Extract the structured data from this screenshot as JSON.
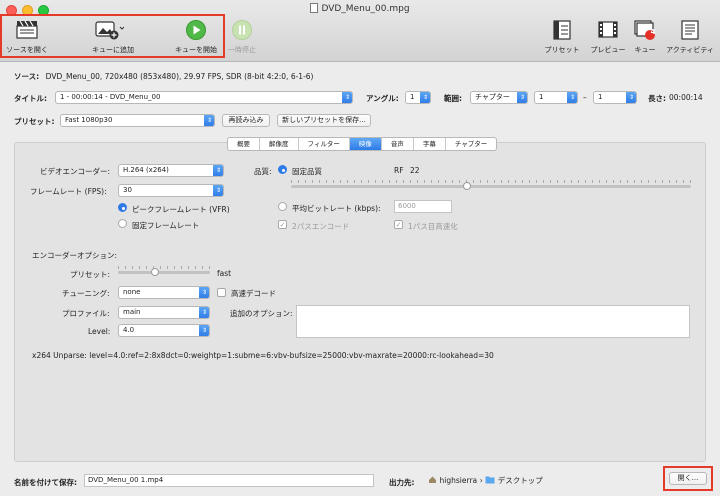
{
  "window": {
    "title": "DVD_Menu_00.mpg"
  },
  "toolbar": {
    "open_source": "ソースを開く",
    "add_to_queue": "キューに追加",
    "start_queue": "キューを開始",
    "pause": "一時停止",
    "presets": "プリセット",
    "preview": "プレビュー",
    "queue": "キュー",
    "queue_badge": "4",
    "activity": "アクティビティ"
  },
  "source": {
    "label": "ソース:",
    "value": "DVD_Menu_00, 720x480 (853x480), 29.97 FPS, SDR (8-bit 4:2:0, 6-1-6)"
  },
  "title_row": {
    "label": "タイトル:",
    "value": "1 - 00:00:14 - DVD_Menu_00",
    "angle_label": "アングル:",
    "angle_value": "1",
    "range_label": "範囲:",
    "range_type": "チャプター",
    "range_start": "1",
    "range_dash": "–",
    "range_end": "1",
    "duration_label": "長さ:",
    "duration_value": "00:00:14"
  },
  "preset_row": {
    "label": "プリセット:",
    "value": "Fast 1080p30",
    "reload": "再読み込み",
    "save_new": "新しいプリセットを保存..."
  },
  "tabs": [
    "概要",
    "解像度",
    "フィルター",
    "映像",
    "音声",
    "字幕",
    "チャプター"
  ],
  "active_tab": "映像",
  "video": {
    "encoder_label": "ビデオエンコーダー:",
    "encoder_value": "H.264 (x264)",
    "framerate_label": "フレームレート (FPS):",
    "framerate_value": "30",
    "peak_fr": "ピークフレームレート (VFR)",
    "constant_fr": "固定フレームレート",
    "quality_label": "品質:",
    "constant_quality": "固定品質",
    "rf_label": "RF",
    "rf_value": "22",
    "rf_fraction": 0.44,
    "avg_bitrate": "平均ビットレート (kbps):",
    "bitrate_value": "6000",
    "twopass": "2パスエンコード",
    "turbo": "1パス目高速化"
  },
  "encoder_options": {
    "heading": "エンコーダーオプション:",
    "preset_label": "プリセット:",
    "preset_value": "fast",
    "preset_fraction": 0.4,
    "tune_label": "チューニング:",
    "tune_value": "none",
    "fastdecode": "高速デコード",
    "profile_label": "プロファイル:",
    "profile_value": "main",
    "extra_label": "追加のオプション:",
    "level_label": "Level:",
    "level_value": "4.0",
    "unparse": "x264 Unparse: level=4.0:ref=2:8x8dct=0:weightp=1:subme=6:vbv-bufsize=25000:vbv-maxrate=20000:rc-lookahead=30"
  },
  "bottom": {
    "save_as_label": "名前を付けて保存:",
    "filename": "DVD_Menu_00 1.mp4",
    "dest_label": "出力先:",
    "user": "highsierra",
    "sep": "›",
    "folder": "デスクトップ",
    "browse": "開く..."
  }
}
